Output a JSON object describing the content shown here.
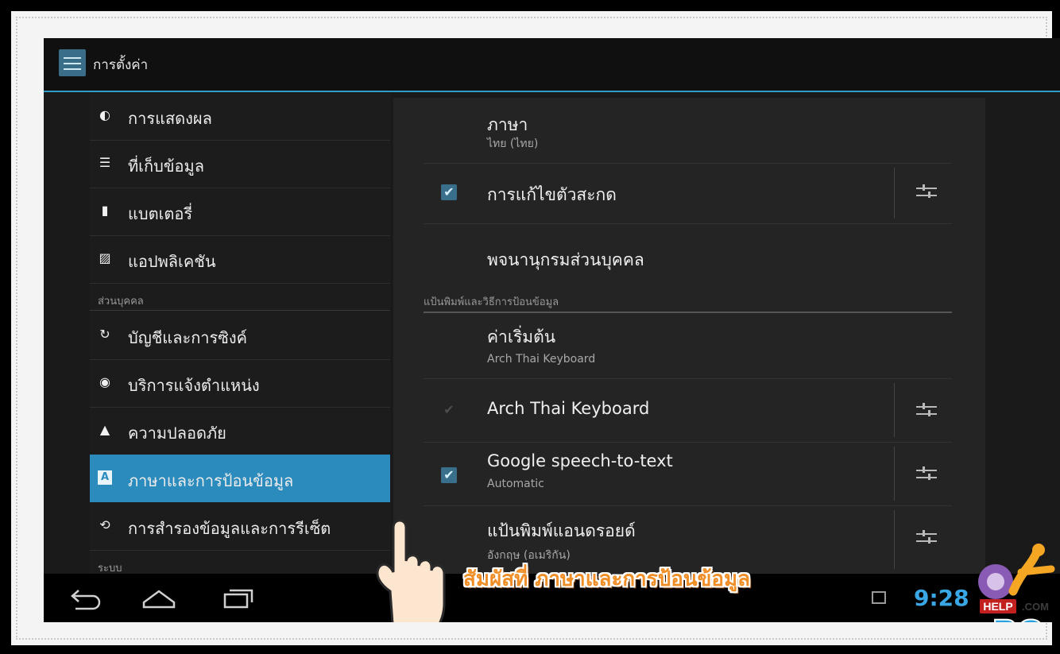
{
  "app": {
    "title": "การตั้งค่า",
    "icon": "settings-sliders-icon"
  },
  "left_menu": {
    "items_top": [
      {
        "label": "การแสดงผล",
        "icon": "brightness-icon"
      },
      {
        "label": "ที่เก็บข้อมูล",
        "icon": "storage-icon"
      },
      {
        "label": "แบตเตอรี่",
        "icon": "battery-icon"
      },
      {
        "label": "แอปพลิเคชัน",
        "icon": "apps-icon"
      }
    ],
    "section_personal": "ส่วนบุคคล",
    "items_personal": [
      {
        "label": "บัญชีและการซิงค์",
        "icon": "sync-icon"
      },
      {
        "label": "บริการแจ้งตำแหน่ง",
        "icon": "location-icon"
      },
      {
        "label": "ความปลอดภัย",
        "icon": "lock-icon"
      },
      {
        "label": "ภาษาและการป้อนข้อมูล",
        "icon": "keyboard-language-icon",
        "selected": true
      },
      {
        "label": "การสำรองข้อมูลและการรีเซ็ต",
        "icon": "backup-icon"
      }
    ],
    "section_system": "ระบบ"
  },
  "right_panel": {
    "language": {
      "title": "ภาษา",
      "summary": "ไทย (ไทย)"
    },
    "spell_checker": {
      "title": "การแก้ไขตัวสะกด",
      "checked": true
    },
    "personal_dictionary": {
      "title": "พจนานุกรมส่วนบุคคล"
    },
    "section_keyboard": "แป้นพิมพ์และวิธีการป้อนข้อมูล",
    "default": {
      "title": "ค่าเริ่มต้น",
      "summary": "Arch Thai Keyboard"
    },
    "arch_thai": {
      "title": "Arch Thai Keyboard",
      "checked": true,
      "disabled": true
    },
    "google_speech": {
      "title": "Google speech-to-text",
      "summary": "Automatic",
      "checked": true
    },
    "android_keyboard": {
      "title": "แป้นพิมพ์แอนดรอยด์",
      "summary": "อังกฤษ (อเมริกัน)"
    }
  },
  "navbar": {
    "time": "9:28"
  },
  "overlay": {
    "caption": "สัมผัสที่ ภาษาและการป้อนข้อมูล"
  },
  "logo": {
    "top_text": "HELP",
    "com_text": ".COM",
    "bottom_text": "PC"
  },
  "colors": {
    "accent": "#2f9bc8",
    "selected": "#2b8bbd",
    "caption": "#f08f28"
  }
}
